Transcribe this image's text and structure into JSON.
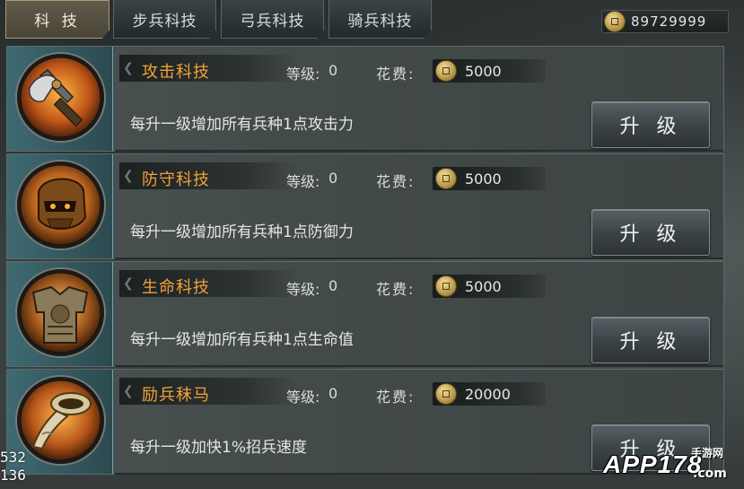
{
  "tabs": [
    {
      "label": "科 技",
      "active": true
    },
    {
      "label": "步兵科技",
      "active": false
    },
    {
      "label": "弓兵科技",
      "active": false
    },
    {
      "label": "骑兵科技",
      "active": false
    }
  ],
  "currency": {
    "icon": "coin-icon",
    "value": "89729999"
  },
  "labels": {
    "level": "等级:",
    "cost": "花费:",
    "upgrade": "升 级"
  },
  "techs": [
    {
      "name": "攻击科技",
      "level": "0",
      "cost": "5000",
      "description": "每升一级增加所有兵种1点攻击力",
      "icon": "battle-axe-icon"
    },
    {
      "name": "防守科技",
      "level": "0",
      "cost": "5000",
      "description": "每升一级增加所有兵种1点防御力",
      "icon": "helmet-icon"
    },
    {
      "name": "生命科技",
      "level": "0",
      "cost": "5000",
      "description": "每升一级增加所有兵种1点生命值",
      "icon": "armor-icon"
    },
    {
      "name": "励兵秣马",
      "level": "0",
      "cost": "20000",
      "description": "每升一级加快1%招兵速度",
      "icon": "war-horn-icon"
    }
  ],
  "overlay": {
    "line1": "532",
    "line2": "136"
  },
  "watermark": {
    "main": "APP178",
    "side": "手游网",
    "sub": ".com"
  },
  "colors": {
    "tech_name": "#f0a33a",
    "accent_teal": "#6fa7b1",
    "button_text": "#eef2f2"
  }
}
